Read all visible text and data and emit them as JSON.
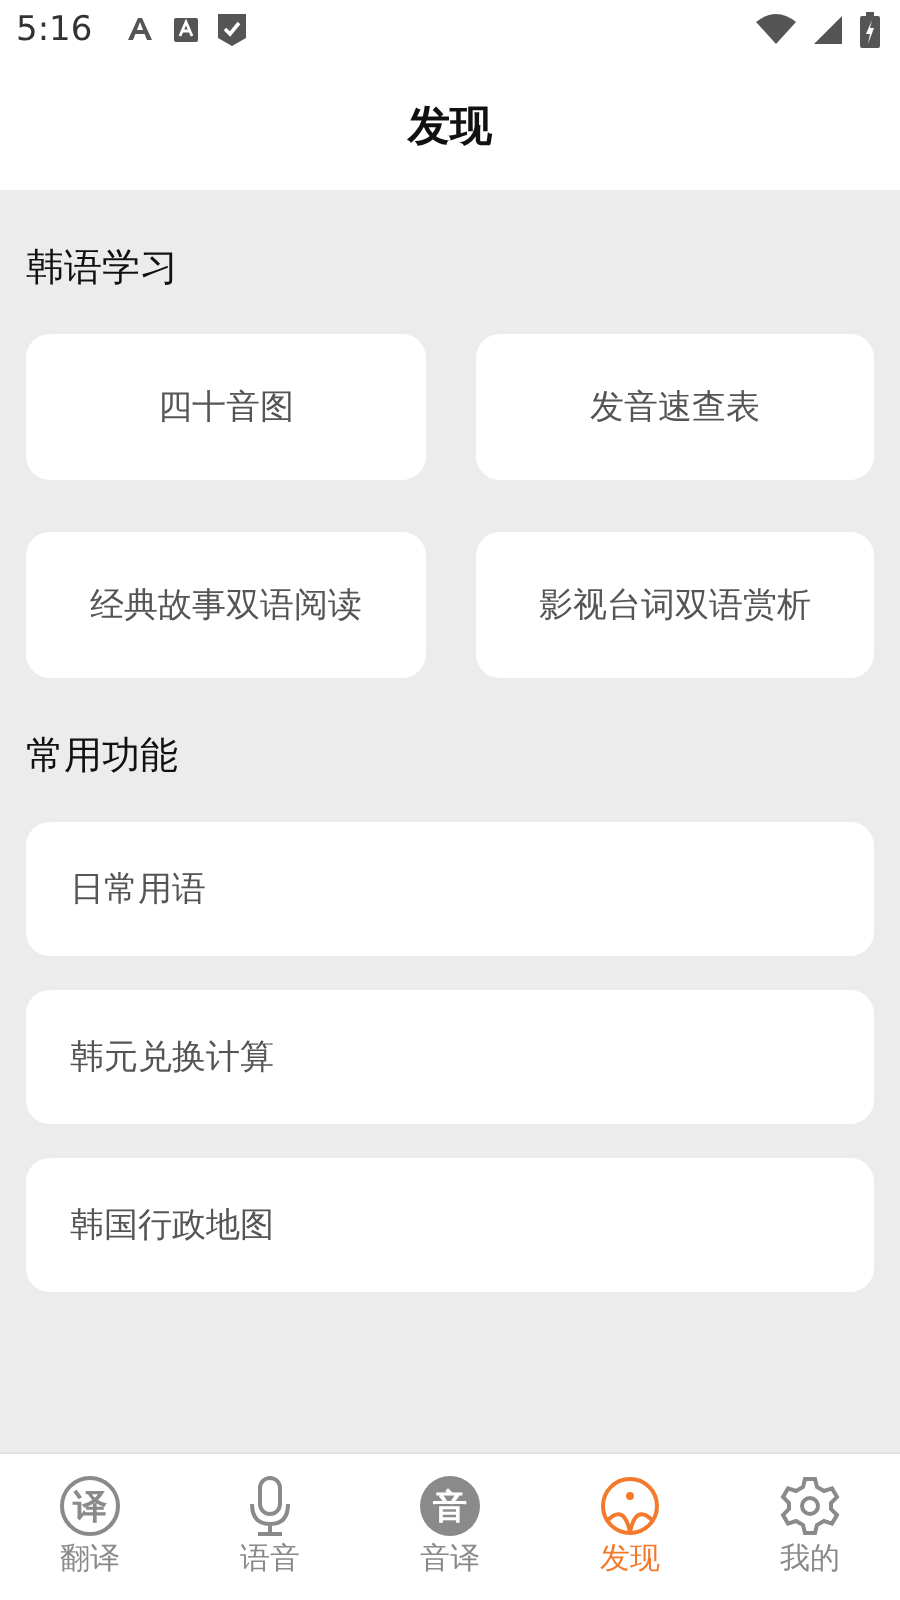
{
  "status_bar": {
    "time": "5:16"
  },
  "header": {
    "title": "发现"
  },
  "sections": [
    {
      "title": "韩语学习",
      "kind": "grid",
      "items": [
        "四十音图",
        "发音速查表",
        "经典故事双语阅读",
        "影视台词双语赏析"
      ]
    },
    {
      "title": "常用功能",
      "kind": "list",
      "items": [
        "日常用语",
        "韩元兑换计算",
        "韩国行政地图"
      ]
    }
  ],
  "bottom_nav": [
    {
      "label": "翻译",
      "kind": "glyph",
      "glyph": "译",
      "selected": false
    },
    {
      "label": "语音",
      "kind": "mic",
      "selected": false
    },
    {
      "label": "音译",
      "kind": "badge",
      "glyph": "音",
      "selected": false
    },
    {
      "label": "发现",
      "kind": "sun",
      "selected": true
    },
    {
      "label": "我的",
      "kind": "gear",
      "selected": false
    }
  ]
}
